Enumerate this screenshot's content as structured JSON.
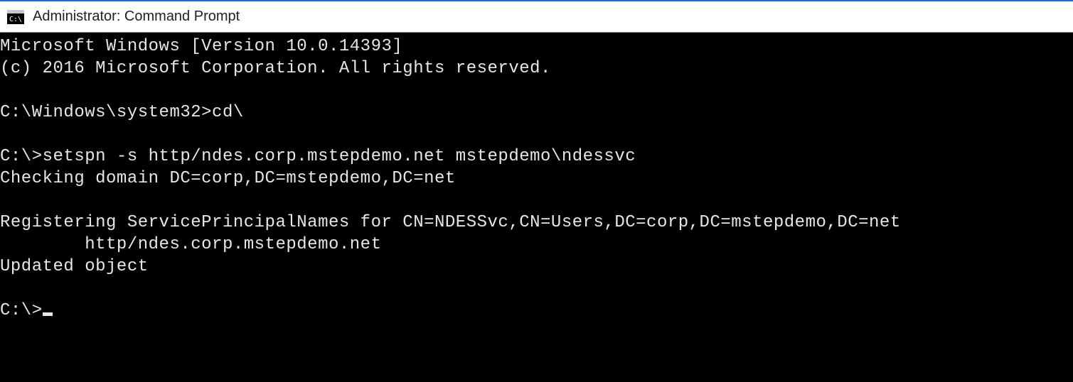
{
  "window": {
    "title": "Administrator: Command Prompt"
  },
  "terminal": {
    "lines": [
      "Microsoft Windows [Version 10.0.14393]",
      "(c) 2016 Microsoft Corporation. All rights reserved.",
      "",
      "C:\\Windows\\system32>cd\\",
      "",
      "C:\\>setspn -s http/ndes.corp.mstepdemo.net mstepdemo\\ndessvc",
      "Checking domain DC=corp,DC=mstepdemo,DC=net",
      "",
      "Registering ServicePrincipalNames for CN=NDESSvc,CN=Users,DC=corp,DC=mstepdemo,DC=net",
      "        http/ndes.corp.mstepdemo.net",
      "Updated object",
      ""
    ],
    "current_prompt": "C:\\>"
  }
}
